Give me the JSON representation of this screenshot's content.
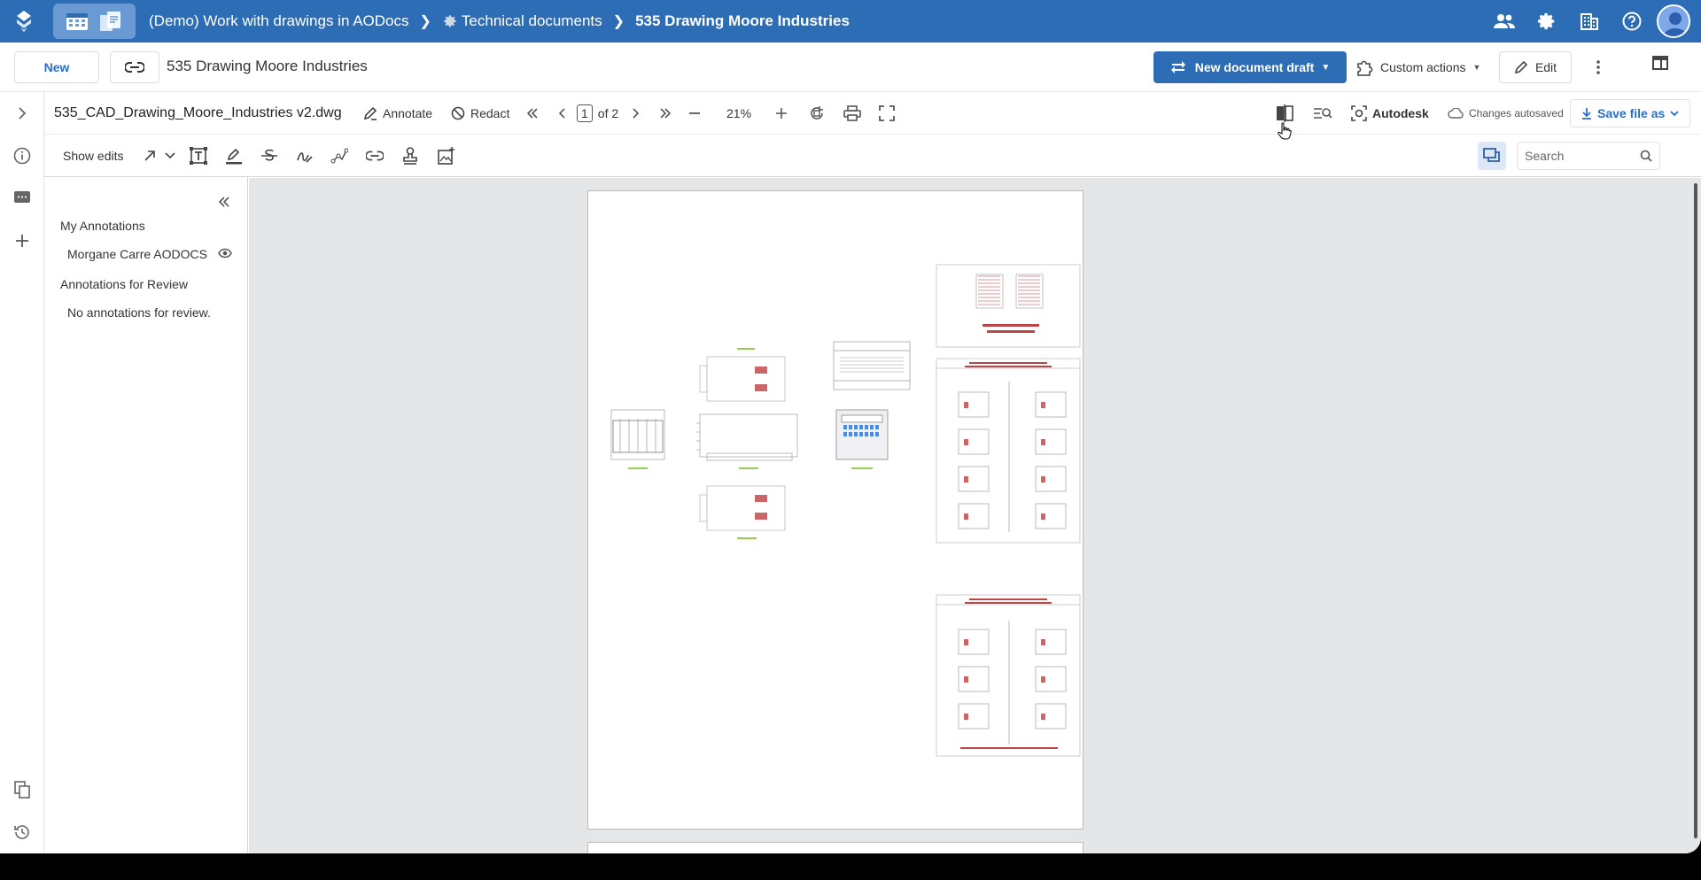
{
  "breadcrumb": {
    "library": "(Demo) Work with drawings in AODocs",
    "folder": "Technical documents",
    "document": "535 Drawing Moore Industries"
  },
  "docbar": {
    "new_label": "New",
    "title": "535 Drawing Moore Industries",
    "new_draft_label": "New document draft",
    "custom_actions_label": "Custom actions",
    "edit_label": "Edit"
  },
  "viewer": {
    "file_name": "535_CAD_Drawing_Moore_Industries v2.dwg",
    "annotate_label": "Annotate",
    "redact_label": "Redact",
    "current_page": "1",
    "page_total": "of 2",
    "zoom": "21%",
    "autodesk_label": "Autodesk",
    "autosave_status": "Changes autosaved",
    "save_as_label": "Save file as",
    "show_edits_label": "Show edits",
    "search_placeholder": "Search"
  },
  "annotations_panel": {
    "my_annotations_label": "My Annotations",
    "user_name": "Morgane Carre AODOCS",
    "review_label": "Annotations for Review",
    "empty_review": "No annotations for review."
  },
  "colors": {
    "brand_blue": "#2d6db5",
    "canvas_gray": "#e5e6e8"
  }
}
